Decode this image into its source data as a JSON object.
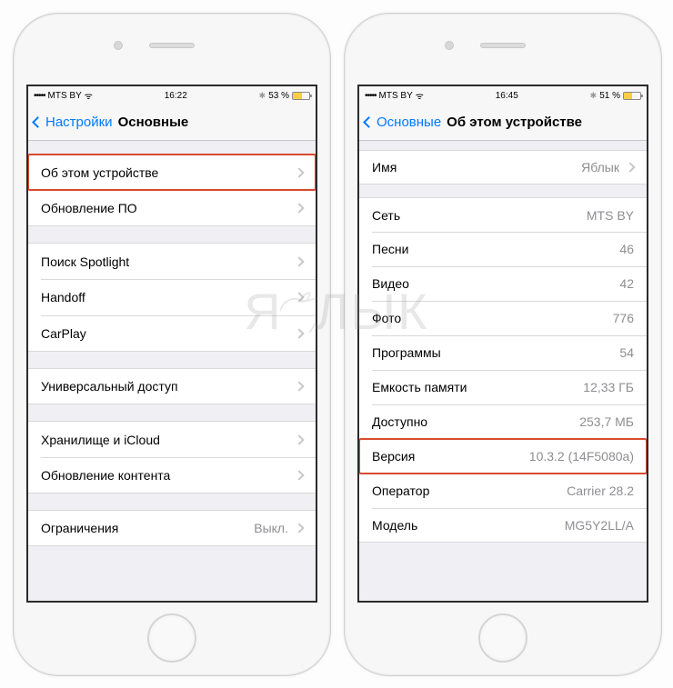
{
  "watermark": {
    "left": "Я",
    "right": "ЛЫК"
  },
  "left_phone": {
    "status": {
      "dots": "•••••",
      "carrier": "MTS BY",
      "wifi": "ᯤ",
      "time": "16:22",
      "bt": "✱",
      "battery_pct": "53 %",
      "battery_fill": "53%"
    },
    "nav": {
      "back": "Настройки",
      "title": "Основные"
    },
    "groups": [
      [
        {
          "label": "Об этом устройстве",
          "disclosure": true,
          "highlight": true
        },
        {
          "label": "Обновление ПО",
          "disclosure": true
        }
      ],
      [
        {
          "label": "Поиск Spotlight",
          "disclosure": true
        },
        {
          "label": "Handoff",
          "disclosure": true
        },
        {
          "label": "CarPlay",
          "disclosure": true
        }
      ],
      [
        {
          "label": "Универсальный доступ",
          "disclosure": true
        }
      ],
      [
        {
          "label": "Хранилище и iCloud",
          "disclosure": true
        },
        {
          "label": "Обновление контента",
          "disclosure": true
        }
      ],
      [
        {
          "label": "Ограничения",
          "value": "Выкл.",
          "disclosure": true
        }
      ]
    ]
  },
  "right_phone": {
    "status": {
      "dots": "•••••",
      "carrier": "MTS BY",
      "wifi": "ᯤ",
      "time": "16:45",
      "bt": "✱",
      "battery_pct": "51 %",
      "battery_fill": "51%"
    },
    "nav": {
      "back": "Основные",
      "title": "Об этом устройстве"
    },
    "groups": [
      [
        {
          "label": "Имя",
          "value": "Яблык",
          "disclosure": true
        }
      ],
      [
        {
          "label": "Сеть",
          "value": "MTS BY"
        },
        {
          "label": "Песни",
          "value": "46"
        },
        {
          "label": "Видео",
          "value": "42"
        },
        {
          "label": "Фото",
          "value": "776"
        },
        {
          "label": "Программы",
          "value": "54"
        },
        {
          "label": "Емкость памяти",
          "value": "12,33 ГБ"
        },
        {
          "label": "Доступно",
          "value": "253,7 МБ"
        },
        {
          "label": "Версия",
          "value": "10.3.2 (14F5080a)",
          "highlight": true
        },
        {
          "label": "Оператор",
          "value": "Carrier 28.2"
        },
        {
          "label": "Модель",
          "value": "MG5Y2LL/A"
        }
      ]
    ]
  }
}
